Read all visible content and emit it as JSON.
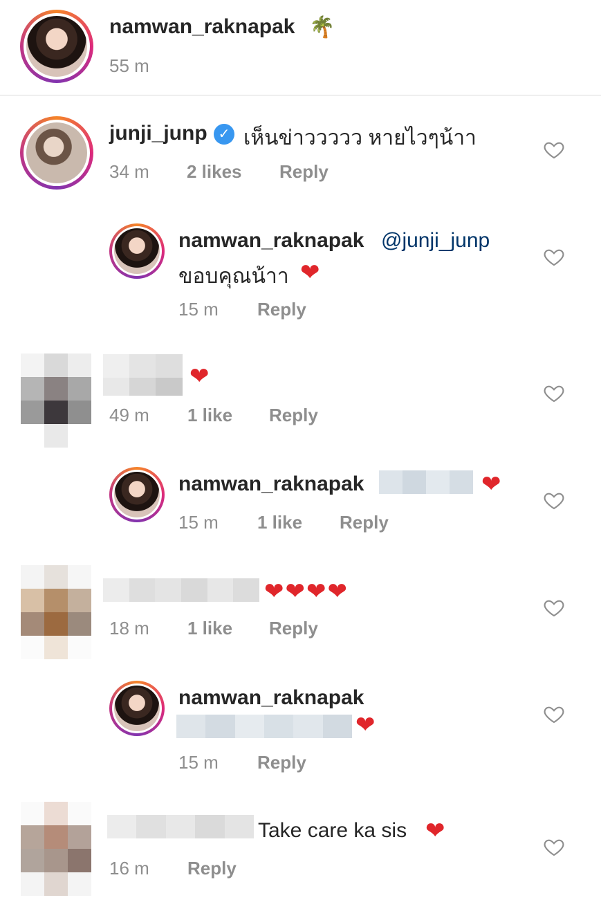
{
  "post": {
    "username": "namwan_raknapak",
    "emoji": "🌴",
    "time": "55 m"
  },
  "comments": [
    {
      "username": "junji_junp",
      "verified": true,
      "text": "เห็นข่าววววว หายไวๆน้าา",
      "time": "34 m",
      "likes": "2 likes",
      "reply": "Reply"
    },
    {
      "username": "namwan_raknapak",
      "mention": "@junji_junp",
      "text": "ขอบคุณน้าา",
      "heart": "❤",
      "time": "15 m",
      "reply": "Reply"
    },
    {
      "username": "",
      "heart": "❤",
      "time": "49 m",
      "likes": "1 like",
      "reply": "Reply"
    },
    {
      "username": "namwan_raknapak",
      "heart": "❤",
      "time": "15 m",
      "likes": "1 like",
      "reply": "Reply"
    },
    {
      "username": "",
      "hearts": "❤❤❤❤",
      "time": "18 m",
      "likes": "1 like",
      "reply": "Reply"
    },
    {
      "username": "namwan_raknapak",
      "heart": "❤",
      "time": "15 m",
      "reply": "Reply"
    },
    {
      "username": "",
      "text": "Take care ka sis",
      "heart": "❤",
      "time": "16 m",
      "reply": "Reply"
    }
  ],
  "icons": {
    "like": "heart-outline-icon",
    "verified": "verified-badge-icon"
  },
  "colors": {
    "mention": "#003569",
    "verified": "#3897f0",
    "heart": "#e0262b",
    "meta": "#8e8e8e"
  }
}
